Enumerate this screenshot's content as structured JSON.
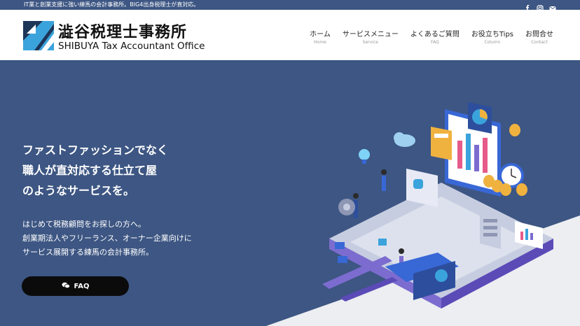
{
  "topbar": {
    "tagline": "IT業と創業支援に強い練馬の会計事務所。BIG4出身税理士が直対応。",
    "social": [
      "facebook-icon",
      "instagram-icon",
      "mail-icon"
    ]
  },
  "logo": {
    "jp": "澁谷税理士事務所",
    "en": "SHIBUYA Tax Accountant Office"
  },
  "nav": [
    {
      "jp": "ホーム",
      "en": "Home"
    },
    {
      "jp": "サービスメニュー",
      "en": "Service"
    },
    {
      "jp": "よくあるご質問",
      "en": "FAQ"
    },
    {
      "jp": "お役立ちTips",
      "en": "Column"
    },
    {
      "jp": "お問合せ",
      "en": "Contact"
    }
  ],
  "hero": {
    "catch": [
      "ファストファッションでなく",
      "職人が直対応する仕立て屋",
      "のようなサービスを。"
    ],
    "sub": [
      "はじめて税務顧問をお探しの方へ。",
      "創業期法人やフリーランス、オーナー企業向けに",
      "サービス展開する練馬の会計事務所。"
    ],
    "button": "FAQ"
  },
  "colors": {
    "primary": "#3d5683",
    "button": "#0b0b0b",
    "accent": "#3ba3dc"
  }
}
